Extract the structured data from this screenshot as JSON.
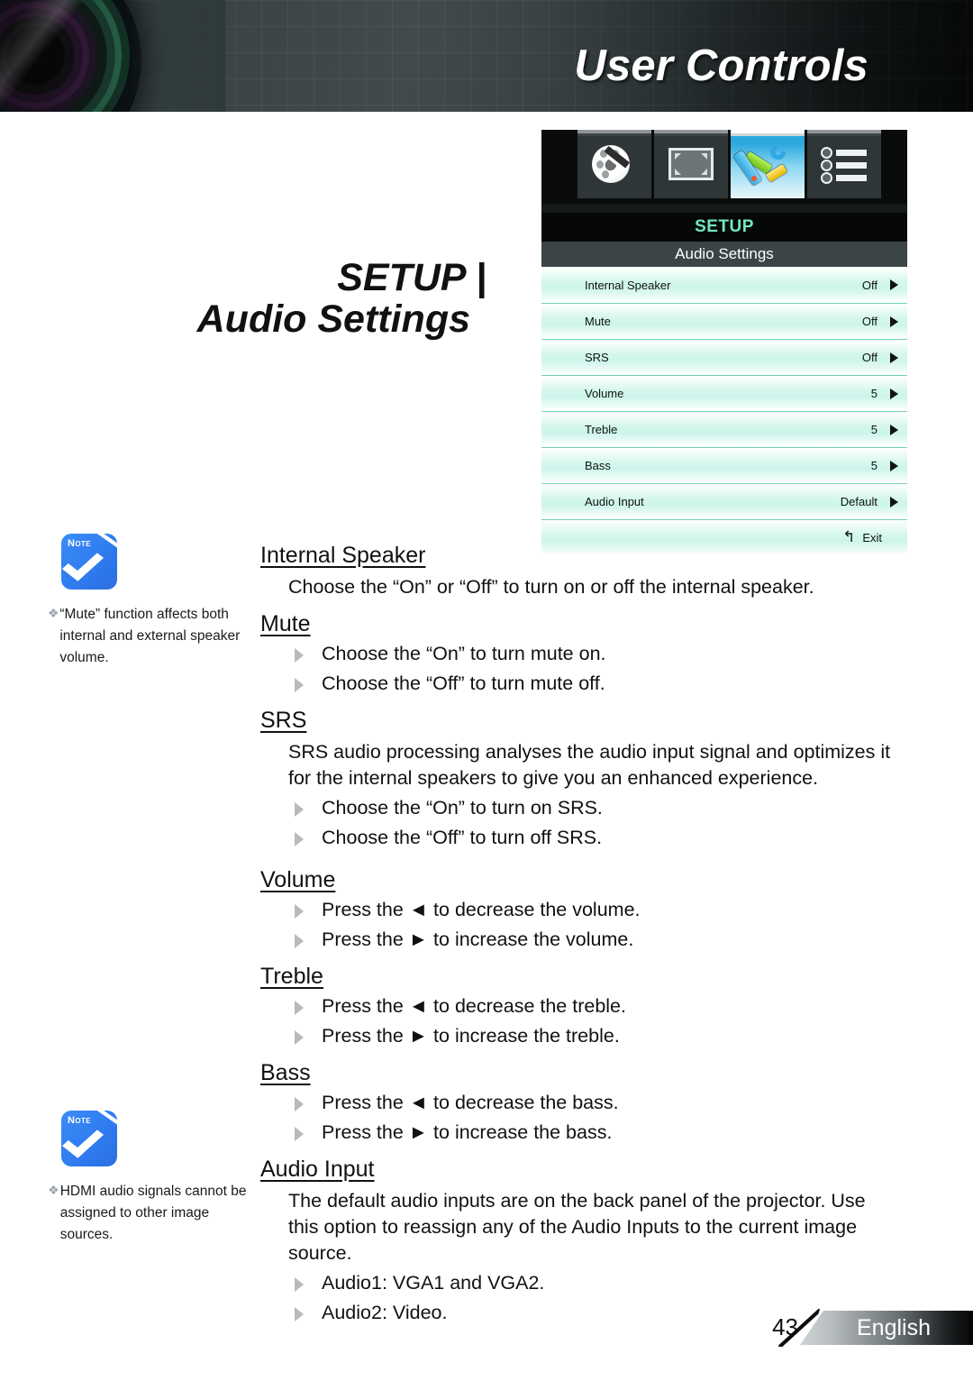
{
  "header": {
    "title": "User Controls",
    "lens_icon": "camera-lens-graphic"
  },
  "section": {
    "line1": "SETUP |",
    "line2": "Audio Settings"
  },
  "osd": {
    "tabs": [
      {
        "name": "image-tab",
        "icon": "palette-brush-icon",
        "selected": false
      },
      {
        "name": "display-tab",
        "icon": "screen-resize-icon",
        "selected": false
      },
      {
        "name": "setup-tab",
        "icon": "tools-wrench-screwdriver-icon",
        "selected": true
      },
      {
        "name": "options-tab",
        "icon": "list-bullets-icon",
        "selected": false
      }
    ],
    "main_title": "SETUP",
    "sub_title": "Audio Settings",
    "rows": [
      {
        "label": "Internal Speaker",
        "value": "Off"
      },
      {
        "label": "Mute",
        "value": "Off"
      },
      {
        "label": "SRS",
        "value": "Off"
      },
      {
        "label": "Volume",
        "value": "5"
      },
      {
        "label": "Treble",
        "value": "5"
      },
      {
        "label": "Bass",
        "value": "5"
      },
      {
        "label": "Audio Input",
        "value": "Default"
      }
    ],
    "exit": {
      "label": "Exit",
      "icon": "back-arrow-icon",
      "glyph": "↰"
    },
    "colors": {
      "title_text": "#73e8c1",
      "row_tint": "#cdf5ea",
      "row_separator": "#6fd3ab"
    }
  },
  "notes": [
    {
      "icon_label": "Note",
      "bullet": "❖",
      "text": "“Mute” function affects both internal and external speaker volume."
    },
    {
      "icon_label": "Note",
      "bullet": "❖",
      "text": "HDMI audio signals cannot be assigned to other image sources."
    }
  ],
  "content": {
    "internal_speaker": {
      "heading": "Internal Speaker",
      "para": "Choose the “On” or “Off” to turn on or off the internal speaker."
    },
    "mute": {
      "heading": "Mute",
      "bullets": [
        "Choose the “On” to turn mute on.",
        "Choose the “Off” to turn mute off."
      ]
    },
    "srs": {
      "heading": "SRS",
      "para": "SRS audio processing analyses the audio input signal and optimizes it for the internal speakers to give you an enhanced experience.",
      "bullets": [
        "Choose the “On” to turn on SRS.",
        "Choose the “Off” to turn off SRS."
      ]
    },
    "volume": {
      "heading": "Volume",
      "bullets": [
        "Press the ◄ to decrease the volume.",
        "Press the ► to increase the volume."
      ]
    },
    "treble": {
      "heading": "Treble",
      "bullets": [
        "Press the ◄ to decrease the treble.",
        "Press the ► to increase the treble."
      ]
    },
    "bass": {
      "heading": "Bass",
      "bullets": [
        "Press the ◄ to decrease the bass.",
        "Press the ► to increase the bass."
      ]
    },
    "audio_input": {
      "heading": "Audio Input",
      "para": "The default audio inputs are on the back panel of the projector. Use this option to reassign any of the Audio Inputs to the current image source.",
      "bullets": [
        "Audio1: VGA1 and VGA2.",
        "Audio2: Video."
      ]
    }
  },
  "footer": {
    "page_number": "43",
    "language": "English"
  }
}
